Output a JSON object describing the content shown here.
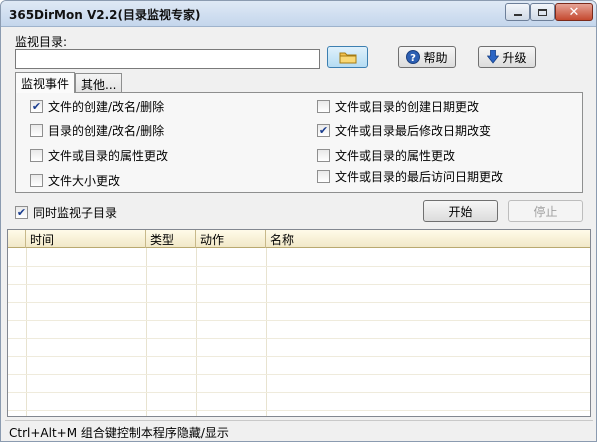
{
  "window": {
    "title": "365DirMon V2.2(目录监视专家)"
  },
  "monitor": {
    "dir_label": "监视目录:",
    "dir_value": "",
    "help_label": "帮助",
    "upgrade_label": "升级"
  },
  "tabs": [
    {
      "label": "监视事件",
      "active": true
    },
    {
      "label": "其他...",
      "active": false
    }
  ],
  "events": {
    "left": [
      {
        "label": "文件的创建/改名/删除",
        "checked": true
      },
      {
        "label": "目录的创建/改名/删除",
        "checked": false
      },
      {
        "label": "文件或目录的属性更改",
        "checked": false
      },
      {
        "label": "文件大小更改",
        "checked": false
      }
    ],
    "right": [
      {
        "label": "文件或目录的创建日期更改",
        "checked": false
      },
      {
        "label": "文件或目录最后修改日期改变",
        "checked": true
      },
      {
        "label": "文件或目录的属性更改",
        "checked": false
      },
      {
        "label": "文件或目录的最后访问日期更改",
        "checked": false
      }
    ]
  },
  "subdirs": {
    "label": "同时监视子目录",
    "checked": true
  },
  "actions": {
    "start_label": "开始",
    "stop_label": "停止"
  },
  "table": {
    "columns": [
      "时间",
      "类型",
      "动作",
      "名称"
    ],
    "rows": []
  },
  "status": {
    "text": "Ctrl+Alt+M 组合键控制本程序隐藏/显示"
  },
  "colors": {
    "title_gradient_top": "#dfe9f5",
    "title_gradient_bottom": "#c4d6ec",
    "close_button": "#c5492f",
    "list_header": "#f1e8c8",
    "checkmark": "#1a3d8f"
  }
}
